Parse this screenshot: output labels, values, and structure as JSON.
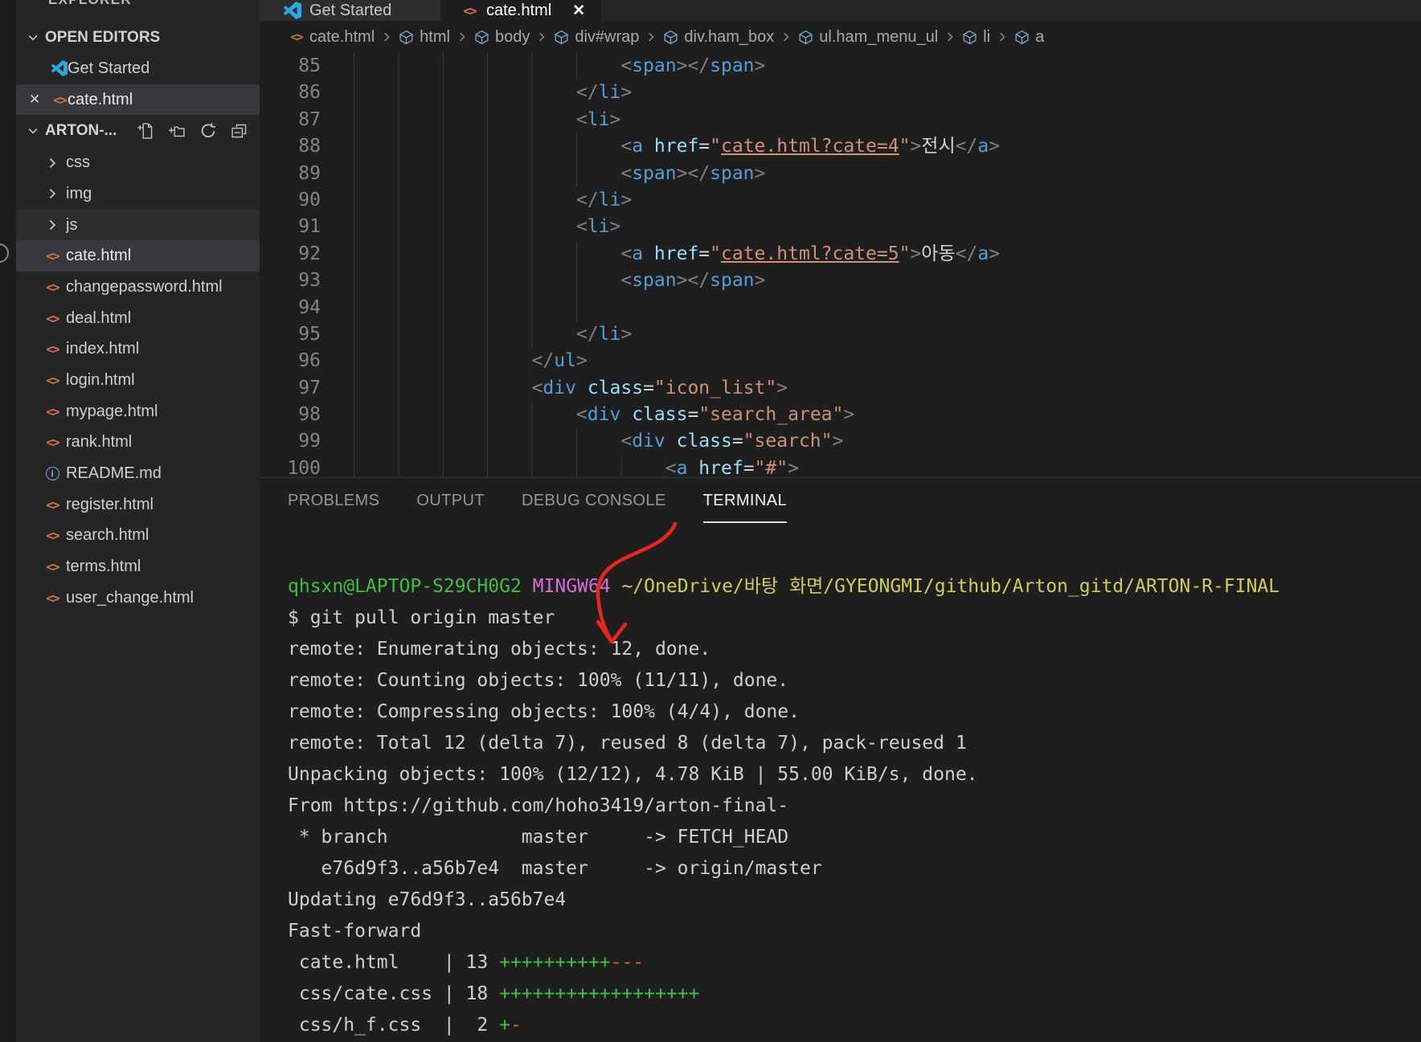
{
  "colors": {
    "tag": "#569cd6",
    "attribute": "#9cdcfe",
    "string": "#ce9178",
    "punctuation": "#808080",
    "plain_text": "#d4d4d4",
    "html_icon": "#cf7342",
    "terminal_green": "#3fc03f",
    "terminal_magenta": "#d670d6",
    "terminal_yellow": "#cfcf53",
    "diff_plus": "#3fc03f",
    "diff_minus": "#e0564f",
    "annotation_red": "#e8251f"
  },
  "sidebar": {
    "title": "EXPLORER",
    "open_editors": {
      "label": "OPEN EDITORS",
      "items": [
        {
          "label": "Get Started",
          "icon": "vscode-logo"
        },
        {
          "label": "cate.html",
          "icon": "html",
          "close": "✕",
          "selected": true
        }
      ]
    },
    "workspace": {
      "label": "ARTON-...",
      "actions": [
        "new-file",
        "new-folder",
        "refresh",
        "collapse-all"
      ],
      "items": [
        {
          "label": "css",
          "type": "folder"
        },
        {
          "label": "img",
          "type": "folder"
        },
        {
          "label": "js",
          "type": "folder",
          "hover": true
        },
        {
          "label": "cate.html",
          "type": "html",
          "selected": true
        },
        {
          "label": "changepassword.html",
          "type": "html"
        },
        {
          "label": "deal.html",
          "type": "html"
        },
        {
          "label": "index.html",
          "type": "html"
        },
        {
          "label": "login.html",
          "type": "html"
        },
        {
          "label": "mypage.html",
          "type": "html"
        },
        {
          "label": "rank.html",
          "type": "html"
        },
        {
          "label": "README.md",
          "type": "info"
        },
        {
          "label": "register.html",
          "type": "html"
        },
        {
          "label": "search.html",
          "type": "html"
        },
        {
          "label": "terms.html",
          "type": "html"
        },
        {
          "label": "user_change.html",
          "type": "html"
        }
      ]
    }
  },
  "editor": {
    "tabs": [
      {
        "label": "Get Started",
        "icon": "vscode-logo",
        "active": false
      },
      {
        "label": "cate.html",
        "icon": "html",
        "close": "✕",
        "active": true
      }
    ],
    "breadcrumb": [
      {
        "label": "cate.html",
        "icon": "html"
      },
      {
        "label": "html",
        "icon": "cube"
      },
      {
        "label": "body",
        "icon": "cube"
      },
      {
        "label": "div#wrap",
        "icon": "cube"
      },
      {
        "label": "div.ham_box",
        "icon": "cube"
      },
      {
        "label": "ul.ham_menu_ul",
        "icon": "cube"
      },
      {
        "label": "li",
        "icon": "cube"
      },
      {
        "label": "a",
        "icon": "cube"
      }
    ],
    "lines": [
      {
        "n": 85,
        "indent": 24,
        "segs": [
          [
            "p",
            "<"
          ],
          [
            "t",
            "span"
          ],
          [
            "p",
            "></"
          ],
          [
            "t",
            "span"
          ],
          [
            "p",
            ">"
          ]
        ]
      },
      {
        "n": 86,
        "indent": 20,
        "segs": [
          [
            "p",
            "</"
          ],
          [
            "t",
            "li"
          ],
          [
            "p",
            ">"
          ]
        ]
      },
      {
        "n": 87,
        "indent": 20,
        "segs": [
          [
            "p",
            "<"
          ],
          [
            "t",
            "li"
          ],
          [
            "p",
            ">"
          ]
        ]
      },
      {
        "n": 88,
        "indent": 24,
        "segs": [
          [
            "p",
            "<"
          ],
          [
            "t",
            "a"
          ],
          [
            "o",
            " "
          ],
          [
            "at",
            "href"
          ],
          [
            "o",
            "="
          ],
          [
            "s",
            "\""
          ],
          [
            "sl",
            "cate.html?cate=4"
          ],
          [
            "s",
            "\""
          ],
          [
            "p",
            ">"
          ],
          [
            "x",
            "전시"
          ],
          [
            "p",
            "</"
          ],
          [
            "t",
            "a"
          ],
          [
            "p",
            ">"
          ]
        ]
      },
      {
        "n": 89,
        "indent": 24,
        "segs": [
          [
            "p",
            "<"
          ],
          [
            "t",
            "span"
          ],
          [
            "p",
            "></"
          ],
          [
            "t",
            "span"
          ],
          [
            "p",
            ">"
          ]
        ]
      },
      {
        "n": 90,
        "indent": 20,
        "segs": [
          [
            "p",
            "</"
          ],
          [
            "t",
            "li"
          ],
          [
            "p",
            ">"
          ]
        ]
      },
      {
        "n": 91,
        "indent": 20,
        "segs": [
          [
            "p",
            "<"
          ],
          [
            "t",
            "li"
          ],
          [
            "p",
            ">"
          ]
        ]
      },
      {
        "n": 92,
        "indent": 24,
        "segs": [
          [
            "p",
            "<"
          ],
          [
            "t",
            "a"
          ],
          [
            "o",
            " "
          ],
          [
            "at",
            "href"
          ],
          [
            "o",
            "="
          ],
          [
            "s",
            "\""
          ],
          [
            "sl",
            "cate.html?cate=5"
          ],
          [
            "s",
            "\""
          ],
          [
            "p",
            ">"
          ],
          [
            "x",
            "아동"
          ],
          [
            "p",
            "</"
          ],
          [
            "t",
            "a"
          ],
          [
            "p",
            ">"
          ]
        ]
      },
      {
        "n": 93,
        "indent": 24,
        "segs": [
          [
            "p",
            "<"
          ],
          [
            "t",
            "span"
          ],
          [
            "p",
            "></"
          ],
          [
            "t",
            "span"
          ],
          [
            "p",
            ">"
          ]
        ]
      },
      {
        "n": 94,
        "indent": 24,
        "segs": []
      },
      {
        "n": 95,
        "indent": 20,
        "segs": [
          [
            "p",
            "</"
          ],
          [
            "t",
            "li"
          ],
          [
            "p",
            ">"
          ]
        ]
      },
      {
        "n": 96,
        "indent": 16,
        "segs": [
          [
            "p",
            "</"
          ],
          [
            "t",
            "ul"
          ],
          [
            "p",
            ">"
          ]
        ]
      },
      {
        "n": 97,
        "indent": 16,
        "segs": [
          [
            "p",
            "<"
          ],
          [
            "t",
            "div"
          ],
          [
            "o",
            " "
          ],
          [
            "at",
            "class"
          ],
          [
            "o",
            "="
          ],
          [
            "s",
            "\"icon_list\""
          ],
          [
            "p",
            ">"
          ]
        ]
      },
      {
        "n": 98,
        "indent": 20,
        "segs": [
          [
            "p",
            "<"
          ],
          [
            "t",
            "div"
          ],
          [
            "o",
            " "
          ],
          [
            "at",
            "class"
          ],
          [
            "o",
            "="
          ],
          [
            "s",
            "\"search_area\""
          ],
          [
            "p",
            ">"
          ]
        ]
      },
      {
        "n": 99,
        "indent": 24,
        "segs": [
          [
            "p",
            "<"
          ],
          [
            "t",
            "div"
          ],
          [
            "o",
            " "
          ],
          [
            "at",
            "class"
          ],
          [
            "o",
            "="
          ],
          [
            "s",
            "\"search\""
          ],
          [
            "p",
            ">"
          ]
        ]
      },
      {
        "n": 100,
        "indent": 28,
        "segs": [
          [
            "p",
            "<"
          ],
          [
            "t",
            "a"
          ],
          [
            "o",
            " "
          ],
          [
            "at",
            "href"
          ],
          [
            "o",
            "="
          ],
          [
            "s",
            "\"#\""
          ],
          [
            "p",
            ">"
          ]
        ]
      }
    ]
  },
  "panel": {
    "tabs": [
      {
        "label": "PROBLEMS",
        "active": false
      },
      {
        "label": "OUTPUT",
        "active": false
      },
      {
        "label": "DEBUG CONSOLE",
        "active": false
      },
      {
        "label": "TERMINAL",
        "active": true
      }
    ],
    "terminal": [
      {
        "segs": [
          [
            "g",
            "qhsxn@LAPTOP-S29CH0G2"
          ],
          [
            "w",
            " "
          ],
          [
            "m",
            "MINGW64"
          ],
          [
            "w",
            " "
          ],
          [
            "y",
            "~/OneDrive/바탕 화면/GYEONGMI/github/Arton_gitd/ARTON-R-FINAL"
          ]
        ]
      },
      {
        "segs": [
          [
            "w",
            "$ git pull origin master"
          ]
        ]
      },
      {
        "segs": [
          [
            "w",
            "remote: Enumerating objects: 12, done."
          ]
        ]
      },
      {
        "segs": [
          [
            "w",
            "remote: Counting objects: 100% (11/11), done."
          ]
        ]
      },
      {
        "segs": [
          [
            "w",
            "remote: Compressing objects: 100% (4/4), done."
          ]
        ]
      },
      {
        "segs": [
          [
            "w",
            "remote: Total 12 (delta 7), reused 8 (delta 7), pack-reused 1"
          ]
        ]
      },
      {
        "segs": [
          [
            "w",
            "Unpacking objects: 100% (12/12), 4.78 KiB | 55.00 KiB/s, done."
          ]
        ]
      },
      {
        "segs": [
          [
            "w",
            "From https://github.com/hoho3419/arton-final-"
          ]
        ]
      },
      {
        "segs": [
          [
            "w",
            " * branch            master     -> FETCH_HEAD"
          ]
        ]
      },
      {
        "segs": [
          [
            "w",
            "   e76d9f3..a56b7e4  master     -> origin/master"
          ]
        ]
      },
      {
        "segs": [
          [
            "w",
            "Updating e76d9f3..a56b7e4"
          ]
        ]
      },
      {
        "segs": [
          [
            "w",
            "Fast-forward"
          ]
        ]
      },
      {
        "segs": [
          [
            "w",
            " cate.html    | 13 "
          ],
          [
            "pl",
            "++++++++++"
          ],
          [
            "mi",
            "---"
          ]
        ]
      },
      {
        "segs": [
          [
            "w",
            " css/cate.css | 18 "
          ],
          [
            "pl",
            "++++++++++++++++++"
          ]
        ]
      },
      {
        "segs": [
          [
            "w",
            " css/h_f.css  |  2 "
          ],
          [
            "pl",
            "+"
          ],
          [
            "mi",
            "-"
          ]
        ]
      }
    ]
  },
  "annotation": {
    "type": "hand-drawn-arrow",
    "color": "#e8251f",
    "points_to": "12"
  }
}
